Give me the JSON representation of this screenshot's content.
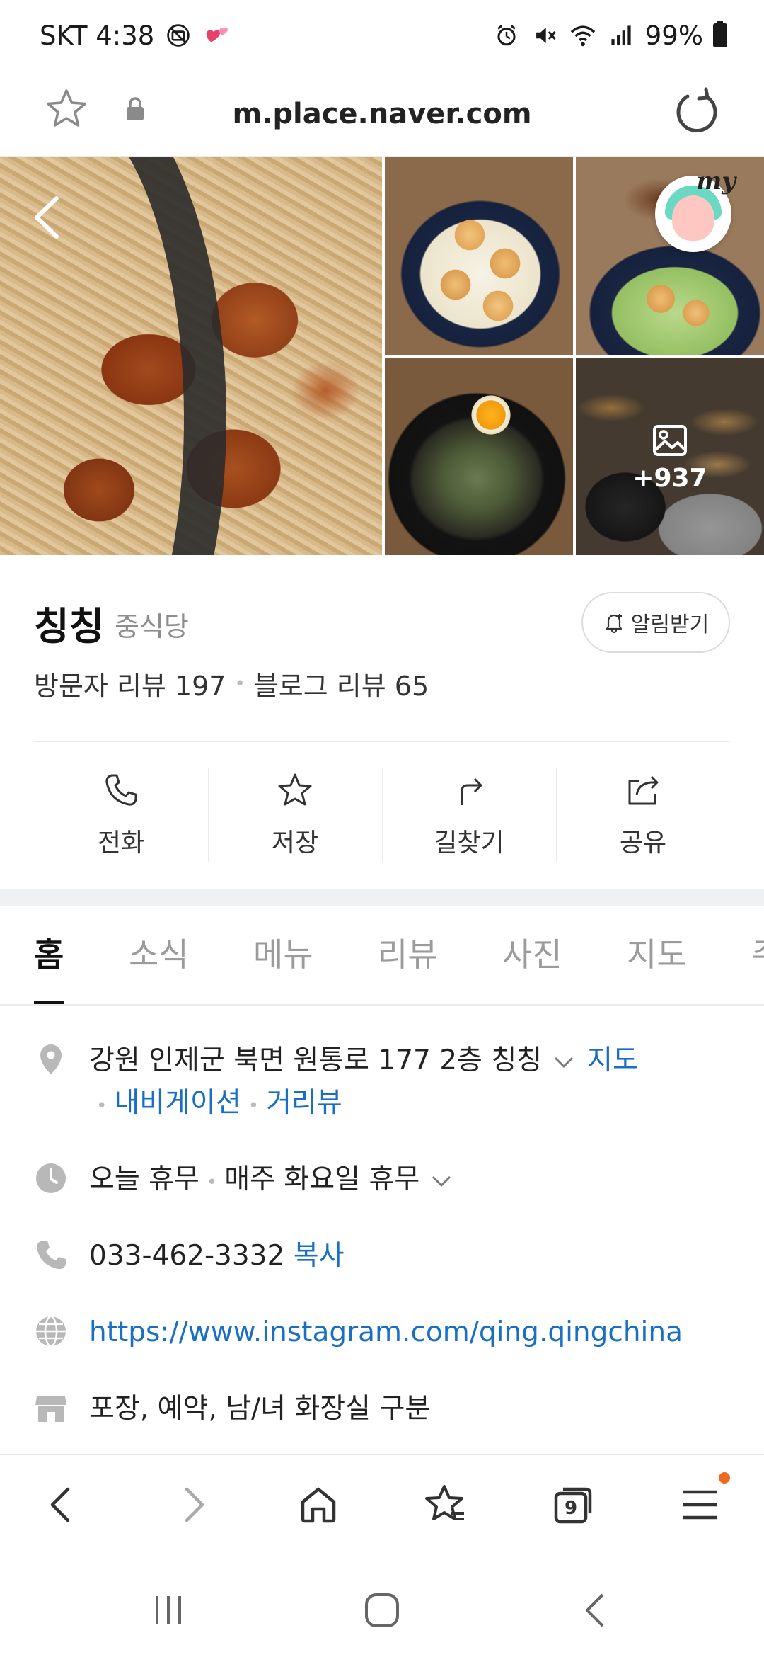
{
  "status_bar": {
    "carrier_time": "SKT 4:38",
    "battery": "99%"
  },
  "browser": {
    "url": "m.place.naver.com"
  },
  "photos": {
    "more_count": "+937",
    "my_badge": "my"
  },
  "place": {
    "name": "칭칭",
    "category": "중식당",
    "notify_label": "알림받기",
    "visitor_reviews": "방문자 리뷰 197",
    "blog_reviews": "블로그 리뷰 65"
  },
  "actions": [
    {
      "label": "전화",
      "icon": "phone-icon"
    },
    {
      "label": "저장",
      "icon": "star-icon"
    },
    {
      "label": "길찾기",
      "icon": "directions-icon"
    },
    {
      "label": "공유",
      "icon": "share-icon"
    }
  ],
  "tabs": [
    "홈",
    "소식",
    "메뉴",
    "리뷰",
    "사진",
    "지도",
    "주"
  ],
  "info": {
    "address": "강원 인제군 북면 원통로 177 2층 칭칭",
    "map_link": "지도",
    "navigation_link": "내비게이션",
    "streetview_link": "거리뷰",
    "hours_today": "오늘 휴무",
    "hours_weekly": "매주 화요일 휴무",
    "phone": "033-462-3332",
    "copy_link": "복사",
    "website": "https://www.instagram.com/qing.qingchina",
    "amenities": "포장, 예약, 남/녀 화장실 구분"
  },
  "browser_nav": {
    "tab_count": "9"
  },
  "colors": {
    "link": "#1a6fc4",
    "accent_dot": "#ef6a20"
  }
}
